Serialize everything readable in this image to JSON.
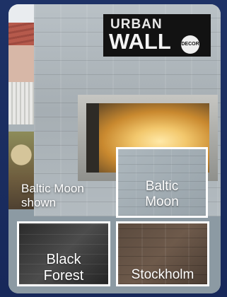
{
  "logo": {
    "line1": "URBAN",
    "line2": "WALL",
    "badge": "DECOR"
  },
  "caption": {
    "line1": "Baltic Moon",
    "line2": "shown"
  },
  "swatches": [
    {
      "line1": "Baltic",
      "line2": "Moon"
    },
    {
      "line1": "Black",
      "line2": "Forest"
    },
    {
      "line1": "Stockholm"
    }
  ],
  "colors": {
    "background": "#1b2d5c",
    "swatch_border": "#ffffff",
    "logo_bg": "#121212"
  }
}
